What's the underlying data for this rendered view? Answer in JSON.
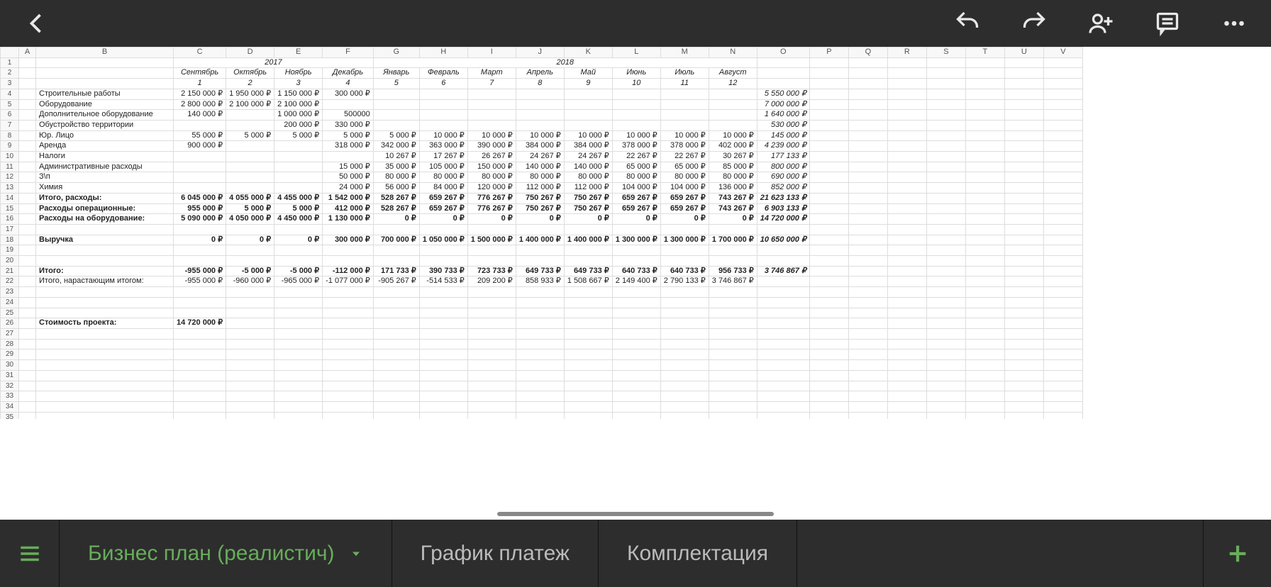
{
  "columns": [
    "A",
    "B",
    "C",
    "D",
    "E",
    "F",
    "G",
    "H",
    "I",
    "J",
    "K",
    "L",
    "M",
    "N",
    "O",
    "P",
    "Q",
    "R",
    "S",
    "T",
    "U",
    "V"
  ],
  "years": {
    "y2017": "2017",
    "y2018": "2018"
  },
  "months": [
    "Сентябрь",
    "Октябрь",
    "Ноябрь",
    "Декабрь",
    "Январь",
    "Февраль",
    "Март",
    "Апрель",
    "Май",
    "Июнь",
    "Июль",
    "Август"
  ],
  "monthNums": [
    "1",
    "2",
    "3",
    "4",
    "5",
    "6",
    "7",
    "8",
    "9",
    "10",
    "11",
    "12"
  ],
  "rows": [
    {
      "label": "Строительные работы",
      "bold": false,
      "vals": [
        "2 150 000 ₽",
        "1 950 000 ₽",
        "1 150 000 ₽",
        "300 000 ₽",
        "",
        "",
        "",
        "",
        "",
        "",
        "",
        ""
      ],
      "total": "5 550 000 ₽"
    },
    {
      "label": "Оборудование",
      "bold": false,
      "vals": [
        "2 800 000 ₽",
        "2 100 000 ₽",
        "2 100 000 ₽",
        "",
        "",
        "",
        "",
        "",
        "",
        "",
        "",
        ""
      ],
      "total": "7 000 000 ₽"
    },
    {
      "label": "Дополнительное оборудование",
      "bold": false,
      "vals": [
        "140 000 ₽",
        "",
        "1 000 000 ₽",
        "500000",
        "",
        "",
        "",
        "",
        "",
        "",
        "",
        ""
      ],
      "total": "1 640 000 ₽"
    },
    {
      "label": "Обустройство территории",
      "bold": false,
      "vals": [
        "",
        "",
        "200 000 ₽",
        "330 000 ₽",
        "",
        "",
        "",
        "",
        "",
        "",
        "",
        ""
      ],
      "total": "530 000 ₽"
    },
    {
      "label": "Юр. Лицо",
      "bold": false,
      "vals": [
        "55 000 ₽",
        "5 000 ₽",
        "5 000 ₽",
        "5 000 ₽",
        "5 000 ₽",
        "10 000 ₽",
        "10 000 ₽",
        "10 000 ₽",
        "10 000 ₽",
        "10 000 ₽",
        "10 000 ₽",
        "10 000 ₽"
      ],
      "total": "145 000 ₽"
    },
    {
      "label": "Аренда",
      "bold": false,
      "vals": [
        "900 000 ₽",
        "",
        "",
        "318 000 ₽",
        "342 000 ₽",
        "363 000 ₽",
        "390 000 ₽",
        "384 000 ₽",
        "384 000 ₽",
        "378 000 ₽",
        "378 000 ₽",
        "402 000 ₽"
      ],
      "total": "4 239 000 ₽"
    },
    {
      "label": "Налоги",
      "bold": false,
      "vals": [
        "",
        "",
        "",
        "",
        "10 267 ₽",
        "17 267 ₽",
        "26 267 ₽",
        "24 267 ₽",
        "24 267 ₽",
        "22 267 ₽",
        "22 267 ₽",
        "30 267 ₽"
      ],
      "total": "177 133 ₽"
    },
    {
      "label": "Административные расходы",
      "bold": false,
      "vals": [
        "",
        "",
        "",
        "15 000 ₽",
        "35 000 ₽",
        "105 000 ₽",
        "150 000 ₽",
        "140 000 ₽",
        "140 000 ₽",
        "65 000 ₽",
        "65 000 ₽",
        "85 000 ₽"
      ],
      "total": "800 000 ₽"
    },
    {
      "label": "З\\п",
      "bold": false,
      "vals": [
        "",
        "",
        "",
        "50 000 ₽",
        "80 000 ₽",
        "80 000 ₽",
        "80 000 ₽",
        "80 000 ₽",
        "80 000 ₽",
        "80 000 ₽",
        "80 000 ₽",
        "80 000 ₽"
      ],
      "total": "690 000 ₽"
    },
    {
      "label": "Химия",
      "bold": false,
      "vals": [
        "",
        "",
        "",
        "24 000 ₽",
        "56 000 ₽",
        "84 000 ₽",
        "120 000 ₽",
        "112 000 ₽",
        "112 000 ₽",
        "104 000 ₽",
        "104 000 ₽",
        "136 000 ₽"
      ],
      "total": "852 000 ₽"
    },
    {
      "label": "Итого, расходы:",
      "bold": true,
      "vals": [
        "6 045 000 ₽",
        "4 055 000 ₽",
        "4 455 000 ₽",
        "1 542 000 ₽",
        "528 267 ₽",
        "659 267 ₽",
        "776 267 ₽",
        "750 267 ₽",
        "750 267 ₽",
        "659 267 ₽",
        "659 267 ₽",
        "743 267 ₽"
      ],
      "total": "21 623 133 ₽"
    },
    {
      "label": "Расходы операционные:",
      "bold": true,
      "vals": [
        "955 000 ₽",
        "5 000 ₽",
        "5 000 ₽",
        "412 000 ₽",
        "528 267 ₽",
        "659 267 ₽",
        "776 267 ₽",
        "750 267 ₽",
        "750 267 ₽",
        "659 267 ₽",
        "659 267 ₽",
        "743 267 ₽"
      ],
      "total": "6 903 133 ₽"
    },
    {
      "label": "Расходы на оборудование:",
      "bold": true,
      "vals": [
        "5 090 000 ₽",
        "4 050 000 ₽",
        "4 450 000 ₽",
        "1 130 000 ₽",
        "0 ₽",
        "0 ₽",
        "0 ₽",
        "0 ₽",
        "0 ₽",
        "0 ₽",
        "0 ₽",
        "0 ₽"
      ],
      "total": "14 720 000 ₽"
    },
    {
      "label": "",
      "blank": true
    },
    {
      "label": "Выручка",
      "bold": true,
      "vals": [
        "0 ₽",
        "0 ₽",
        "0 ₽",
        "300 000 ₽",
        "700 000 ₽",
        "1 050 000 ₽",
        "1 500 000 ₽",
        "1 400 000 ₽",
        "1 400 000 ₽",
        "1 300 000 ₽",
        "1 300 000 ₽",
        "1 700 000 ₽"
      ],
      "total": "10 650 000 ₽"
    },
    {
      "label": "",
      "blank": true
    },
    {
      "label": "",
      "blank": true
    },
    {
      "label": "Итого:",
      "bold": true,
      "vals": [
        "-955 000 ₽",
        "-5 000 ₽",
        "-5 000 ₽",
        "-112 000 ₽",
        "171 733 ₽",
        "390 733 ₽",
        "723 733 ₽",
        "649 733 ₽",
        "649 733 ₽",
        "640 733 ₽",
        "640 733 ₽",
        "956 733 ₽"
      ],
      "total": "3 746 867 ₽"
    },
    {
      "label": "Итого, нарастающим итогом:",
      "bold": false,
      "vals": [
        "-955 000 ₽",
        "-960 000 ₽",
        "-965 000 ₽",
        "-1 077 000 ₽",
        "-905 267 ₽",
        "-514 533 ₽",
        "209 200 ₽",
        "858 933 ₽",
        "1 508 667 ₽",
        "2 149 400 ₽",
        "2 790 133 ₽",
        "3 746 867 ₽"
      ],
      "total": ""
    },
    {
      "label": "",
      "blank": true
    },
    {
      "label": "",
      "blank": true
    },
    {
      "label": "",
      "blank": true
    },
    {
      "label": "Стоимость проекта:",
      "bold": true,
      "vals": [
        "14 720 000 ₽",
        "",
        "",
        "",
        "",
        "",
        "",
        "",
        "",
        "",
        "",
        ""
      ],
      "total": ""
    }
  ],
  "emptyRows": 10,
  "startDataRow": 4,
  "tabs": {
    "active": "Бизнес план (реалистич)",
    "others": [
      "График платеж",
      "Комплектация"
    ]
  }
}
